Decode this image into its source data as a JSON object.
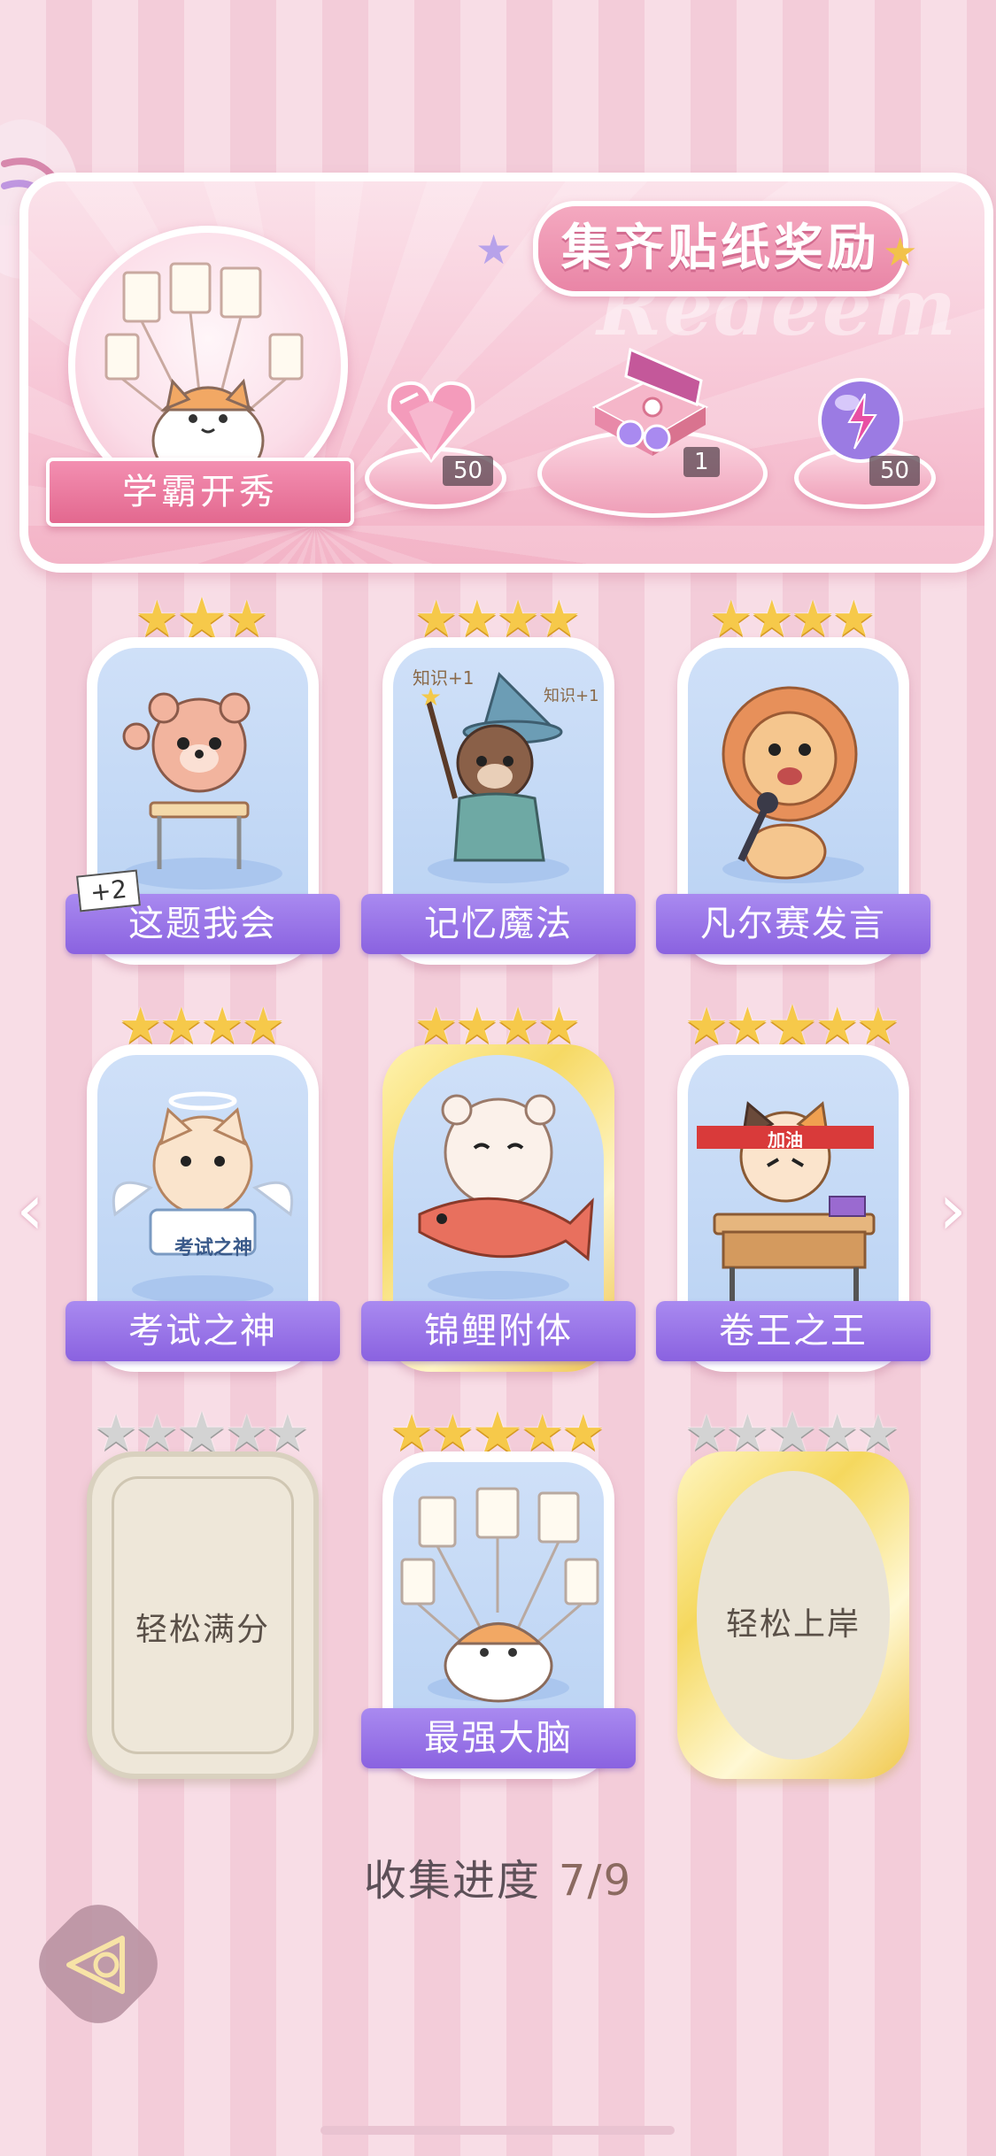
{
  "banner": {
    "title": "集齐贴纸奖励",
    "watermark": "Redeem",
    "medal_label": "学霸开秀",
    "rewards": [
      {
        "icon": "pink-diamond-icon",
        "count": "50"
      },
      {
        "icon": "gift-box-icon",
        "count": "1"
      },
      {
        "icon": "lightning-orb-icon",
        "count": "50"
      }
    ]
  },
  "cards": [
    {
      "label": "这题我会",
      "stars": 3,
      "state": "collected",
      "badge": "+2",
      "character": "bear at desk"
    },
    {
      "label": "记忆魔法",
      "stars": 4,
      "state": "collected",
      "character": "wizard otter",
      "decor": [
        "知识+1",
        "知识+1"
      ]
    },
    {
      "label": "凡尔赛发言",
      "stars": 4,
      "state": "collected",
      "character": "lion with microphone"
    },
    {
      "label": "考试之神",
      "stars": 4,
      "state": "collected",
      "character": "angel cat",
      "sign": "考试之神"
    },
    {
      "label": "锦鲤附体",
      "stars": 4,
      "state": "collected-gold",
      "character": "bear with koi fish"
    },
    {
      "label": "卷王之王",
      "stars": 5,
      "state": "collected",
      "character": "studying cat",
      "headband": "加油"
    },
    {
      "label": "轻松满分",
      "stars": 5,
      "state": "locked"
    },
    {
      "label": "最强大脑",
      "stars": 5,
      "state": "collected",
      "character": "cat with papers"
    },
    {
      "label": "轻松上岸",
      "stars": 5,
      "state": "locked-gold"
    }
  ],
  "progress": {
    "label": "收集进度",
    "value": "7/9"
  },
  "colors": {
    "accent": "#8a62e0",
    "star": "#f6c94a",
    "banner": "#f3b4c7"
  }
}
